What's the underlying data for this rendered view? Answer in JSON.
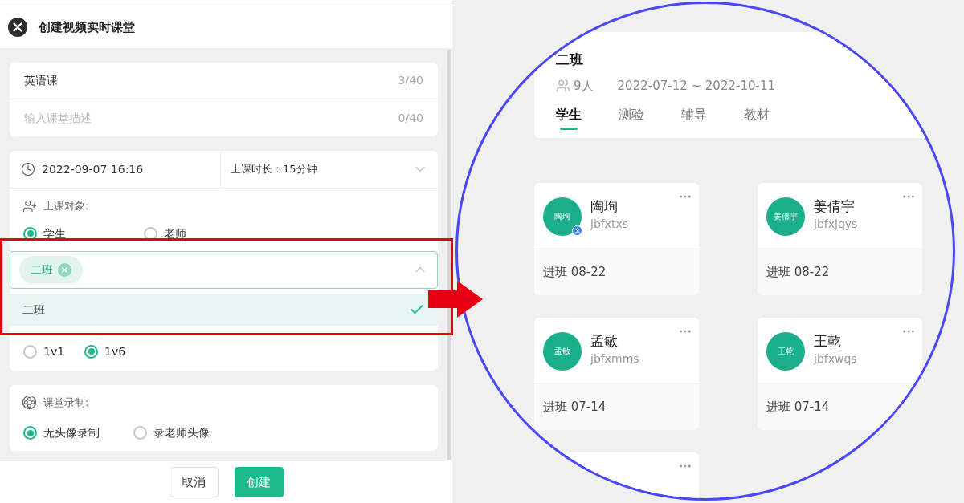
{
  "dialog": {
    "title": "创建视频实时课堂"
  },
  "course": {
    "name": "英语课",
    "name_count": "3/40",
    "description_placeholder": "输入课堂描述",
    "description_count": "0/40"
  },
  "schedule": {
    "start": "2022-09-07 16:16",
    "duration": "上课时长：15分钟"
  },
  "audience": {
    "label": "上课对象:",
    "options": [
      {
        "label": "学生",
        "selected": true
      },
      {
        "label": "老师",
        "selected": false
      }
    ],
    "select": {
      "tags": [
        "二班"
      ],
      "expanded": true
    },
    "dropdown": [
      {
        "label": "二班",
        "selected": true
      }
    ],
    "modes": [
      {
        "label": "1v1",
        "selected": false
      },
      {
        "label": "1v6",
        "selected": true
      }
    ]
  },
  "recording": {
    "label": "课堂录制:",
    "options": [
      {
        "label": "无头像录制",
        "selected": true
      },
      {
        "label": "录老师头像",
        "selected": false
      }
    ]
  },
  "buttons": [
    {
      "label": "取消",
      "kind": "secondary"
    },
    {
      "label": "创建",
      "kind": "primary"
    }
  ],
  "zoom": {
    "class_name": "二班",
    "member_count": "9人",
    "date_range": "2022-07-12 ~ 2022-10-11",
    "tabs": [
      {
        "label": "学生",
        "selected": true
      },
      {
        "label": "测验",
        "selected": false
      },
      {
        "label": "辅导",
        "selected": false
      },
      {
        "label": "教材",
        "selected": false
      }
    ],
    "students": [
      {
        "name": "陶珣",
        "avatar": "陶珣",
        "account": "jbfxtxs",
        "joined": "进班 08-22",
        "badge": true
      },
      {
        "name": "姜倩宇",
        "avatar": "姜倩宇",
        "account": "jbfxjqys",
        "joined": "进班 08-22",
        "badge": false
      },
      {
        "name": "孟敏",
        "avatar": "孟敏",
        "account": "jbfxmms",
        "joined": "进班 07-14",
        "badge": false
      },
      {
        "name": "王乾",
        "avatar": "王乾",
        "account": "jbfxwqs",
        "joined": "进班 07-14",
        "badge": false
      }
    ]
  }
}
